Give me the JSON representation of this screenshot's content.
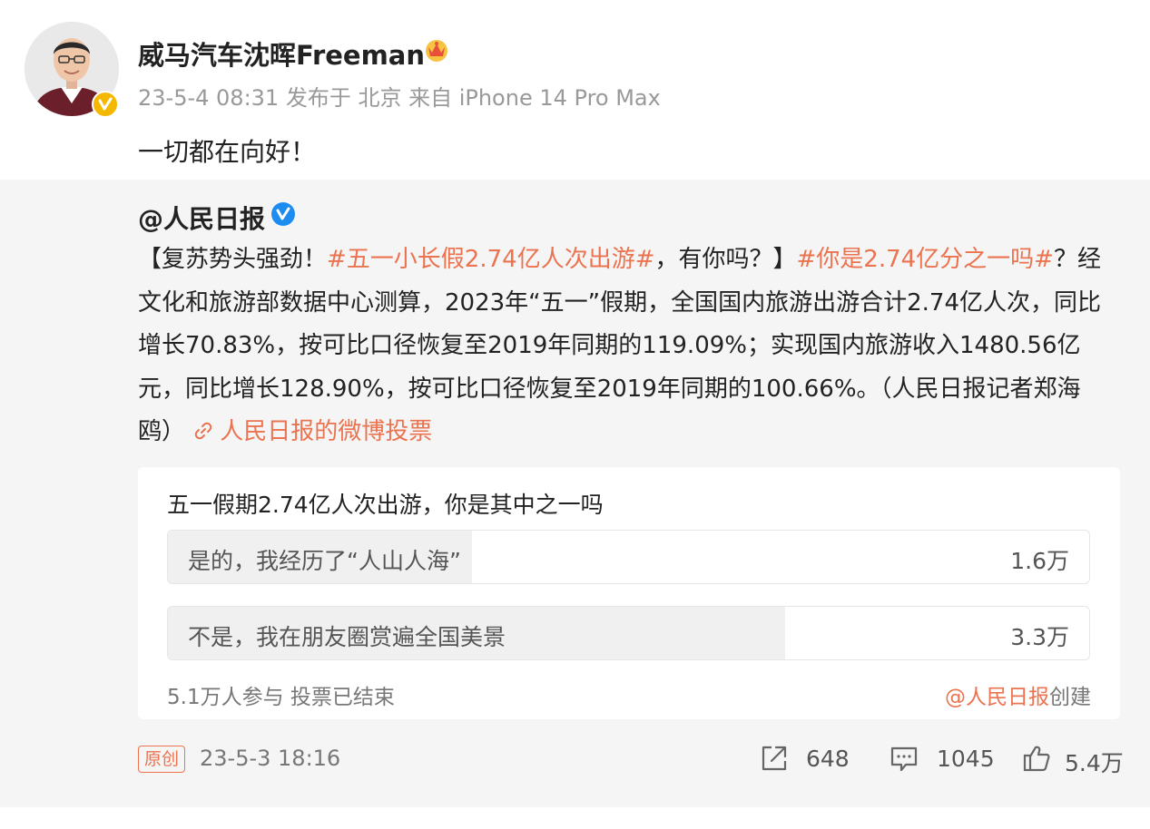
{
  "post": {
    "author": "威马汽车沈晖Freeman",
    "meta": "23-5-4 08:31 发布于 北京 来自 iPhone 14 Pro Max",
    "text": "一切都在向好！"
  },
  "repost": {
    "author": "@人民日报",
    "body": {
      "p1": "【复苏势头强劲！",
      "tag1": "#五一小长假2.74亿人次出游#",
      "p2": "，有你吗？】",
      "tag2": "#你是2.74亿分之一吗#",
      "p3": "？经文化和旅游部数据中心测算，2023年“五一”假期，全国国内旅游出游合计2.74亿人次，同比增长70.83%，按可比口径恢复至2019年同期的119.09%；实现国内旅游收入1480.56亿元，同比增长128.90%，按可比口径恢复至2019年同期的100.66%。（人民日报记者郑海鸥）",
      "link": "人民日报的微博投票"
    },
    "poll": {
      "title": "五一假期2.74亿人次出游，你是其中之一吗",
      "options": [
        {
          "label": "是的，我经历了“人山人海”",
          "count": "1.6万",
          "fraction": 0.33
        },
        {
          "label": "不是，我在朋友圈赏遍全国美景",
          "count": "3.3万",
          "fraction": 0.67
        }
      ],
      "footer": "5.1万人参与 投票已结束",
      "creator_account": "@人民日报",
      "creator_suffix": "创建"
    },
    "footer": {
      "badge": "原创",
      "time": "23-5-3 18:16",
      "shares": "648",
      "comments": "1045",
      "likes": "5.4万"
    }
  },
  "colors": {
    "accent": "#eb7350",
    "verified_gold": "#f5b800",
    "verified_blue": "#1d8cf0"
  },
  "icons": [
    "crown-icon",
    "verified-icon",
    "link-icon",
    "share-icon",
    "comment-icon",
    "like-icon"
  ]
}
